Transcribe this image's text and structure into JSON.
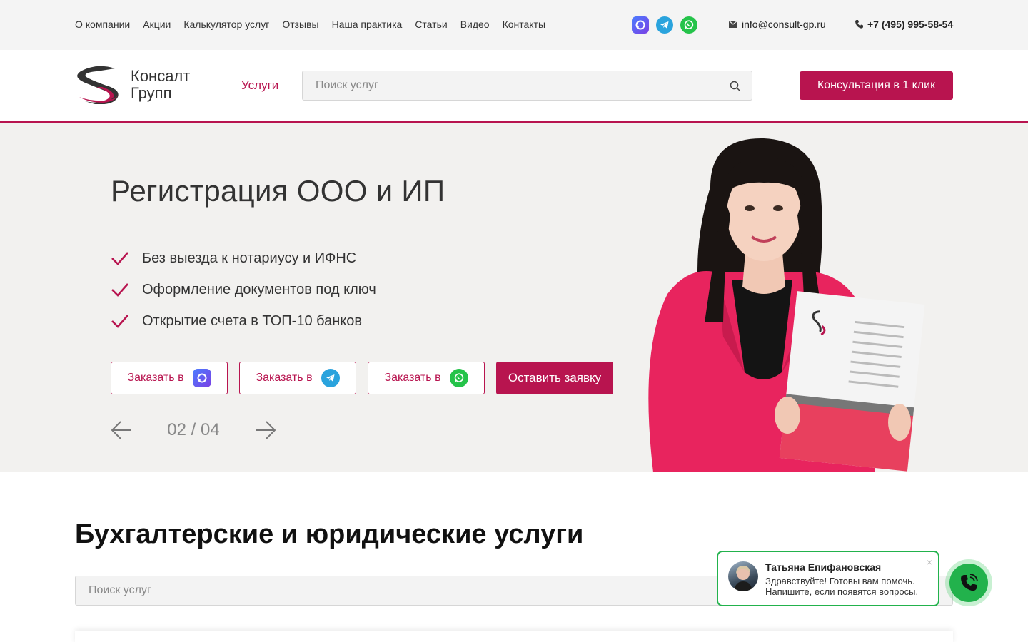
{
  "topbar": {
    "nav": [
      "О компании",
      "Акции",
      "Калькулятор услуг",
      "Отзывы",
      "Наша практика",
      "Статьи",
      "Видео",
      "Контакты"
    ],
    "email": "info@consult-gp.ru",
    "phone": "+7 (495) 995-58-54",
    "socials": [
      "max-icon",
      "telegram-icon",
      "whatsapp-icon"
    ]
  },
  "header": {
    "logo_line1": "Консалт",
    "logo_line2": "Групп",
    "services_label": "Услуги",
    "search_placeholder": "Поиск услуг",
    "cta_label": "Консультация в 1 клик"
  },
  "hero": {
    "title": "Регистрация ООО и ИП",
    "features": [
      "Без выезда к нотариусу и ИФНС",
      "Оформление документов под ключ",
      "Открытие счета в ТОП-10 банков"
    ],
    "order_label": "Заказать в",
    "apply_label": "Оставить заявку",
    "counter": "02 / 04"
  },
  "section": {
    "title": "Бухгалтерские и юридические услуги",
    "search_placeholder": "Поиск услуг"
  },
  "chat": {
    "name": "Татьяна Епифановская",
    "message": "Здравствуйте! Готовы вам помочь. Напишите, если появятся вопросы.",
    "close": "×"
  },
  "colors": {
    "brand": "#b8144f",
    "topbar_bg": "#f4f4f4",
    "hero_bg": "#f2f1ef",
    "chat_green": "#22b24c"
  }
}
